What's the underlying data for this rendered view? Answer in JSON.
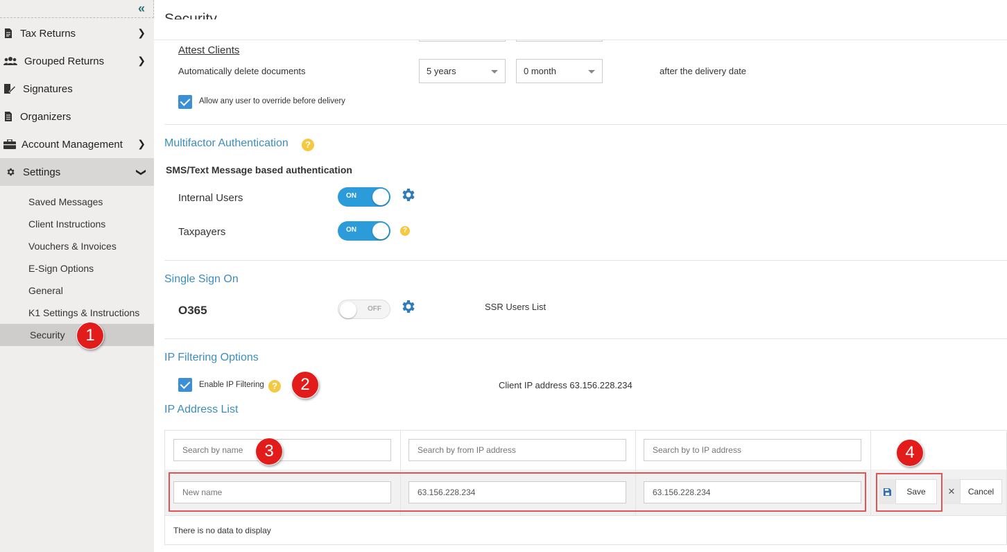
{
  "sidebar": {
    "items": [
      {
        "label": "Tax Returns"
      },
      {
        "label": "Grouped Returns"
      },
      {
        "label": "Signatures"
      },
      {
        "label": "Organizers"
      },
      {
        "label": "Account Management"
      },
      {
        "label": "Settings"
      }
    ],
    "sub_items": [
      {
        "label": "Saved Messages"
      },
      {
        "label": "Client Instructions"
      },
      {
        "label": "Vouchers & Invoices"
      },
      {
        "label": "E-Sign Options"
      },
      {
        "label": "General"
      },
      {
        "label": "K1 Settings & Instructions"
      },
      {
        "label": "Security"
      }
    ]
  },
  "page": {
    "title": "Security"
  },
  "attest": {
    "link": "Attest Clients",
    "label": "Automatically delete documents",
    "years": "5 years",
    "months": "0 month",
    "suffix": "after the delivery date",
    "override": "Allow any user to override before delivery"
  },
  "mfa": {
    "heading": "Multifactor Authentication",
    "subheading": "SMS/Text Message based authentication",
    "internal_label": "Internal Users",
    "taxpayers_label": "Taxpayers",
    "on_text": "ON"
  },
  "sso": {
    "heading": "Single Sign On",
    "label": "O365",
    "off_text": "OFF",
    "users_list": "SSR Users List"
  },
  "ip": {
    "heading": "IP Filtering Options",
    "enable_label": "Enable IP Filtering",
    "client_ip": "Client IP address 63.156.228.234",
    "list_heading": "IP Address List",
    "search_name": "Search by name",
    "search_from": "Search by from IP address",
    "search_to": "Search by to IP address",
    "new_name": "New name",
    "from_value": "63.156.228.234",
    "to_value": "63.156.228.234",
    "save": "Save",
    "cancel": "Cancel",
    "empty": "There is no data to display"
  },
  "badges": [
    "1",
    "2",
    "3",
    "4"
  ],
  "colors": {
    "accent": "#3c8dbc",
    "toggle_on": "#2b9bd9",
    "badge": "#e21b1b",
    "help": "#f5c842"
  }
}
